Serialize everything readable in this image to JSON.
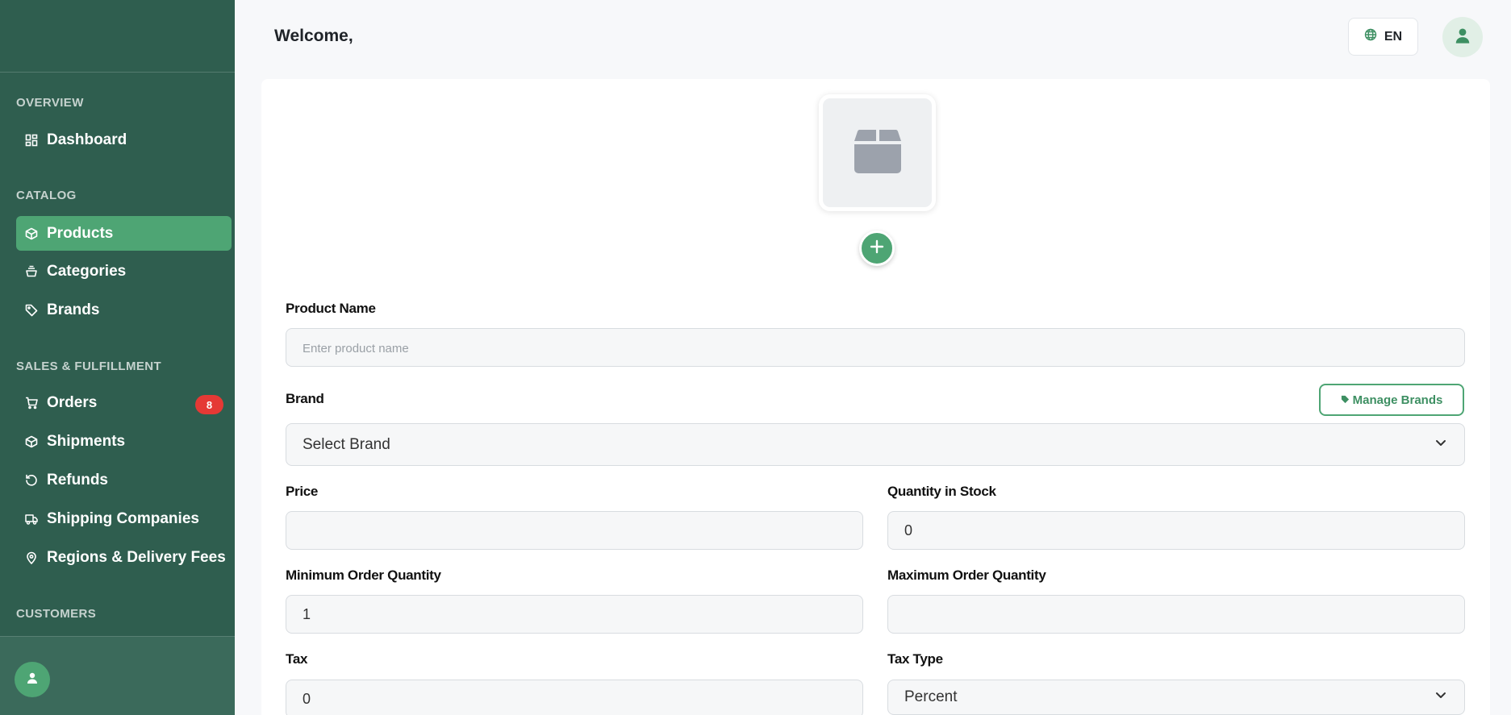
{
  "header": {
    "welcome": "Welcome,",
    "language": "EN"
  },
  "sidebar": {
    "sections": {
      "overview": "OVERVIEW",
      "catalog": "CATALOG",
      "sales": "SALES & FULFILLMENT",
      "customers": "CUSTOMERS"
    },
    "items": {
      "dashboard": "Dashboard",
      "products": "Products",
      "categories": "Categories",
      "brands": "Brands",
      "orders": "Orders",
      "shipments": "Shipments",
      "refunds": "Refunds",
      "shipping_companies": "Shipping Companies",
      "regions": "Regions & Delivery Fees"
    },
    "orders_badge": "8",
    "active_item": "Products"
  },
  "form": {
    "product_name_label": "Product Name",
    "product_name_placeholder": "Enter product name",
    "product_name_value": "",
    "brand_label": "Brand",
    "brand_selected": "Select Brand",
    "manage_brands": "Manage Brands",
    "price_label": "Price",
    "price_value": "",
    "quantity_label": "Quantity in Stock",
    "quantity_value": "0",
    "min_order_label": "Minimum Order Quantity",
    "min_order_value": "1",
    "max_order_label": "Maximum Order Quantity",
    "max_order_value": "",
    "tax_label": "Tax",
    "tax_value": "0",
    "tax_type_label": "Tax Type",
    "tax_type_selected": "Percent"
  },
  "colors": {
    "sidebar_bg": "#2f5e4f",
    "accent": "#4ea574",
    "badge": "#e53935"
  },
  "icons": [
    "dashboard-icon",
    "box-icon",
    "basket-icon",
    "tag-icon",
    "cart-icon",
    "refund-icon",
    "truck-icon",
    "map-pin-icon",
    "globe-icon",
    "user-icon",
    "plus-icon",
    "chevron-down-icon"
  ]
}
